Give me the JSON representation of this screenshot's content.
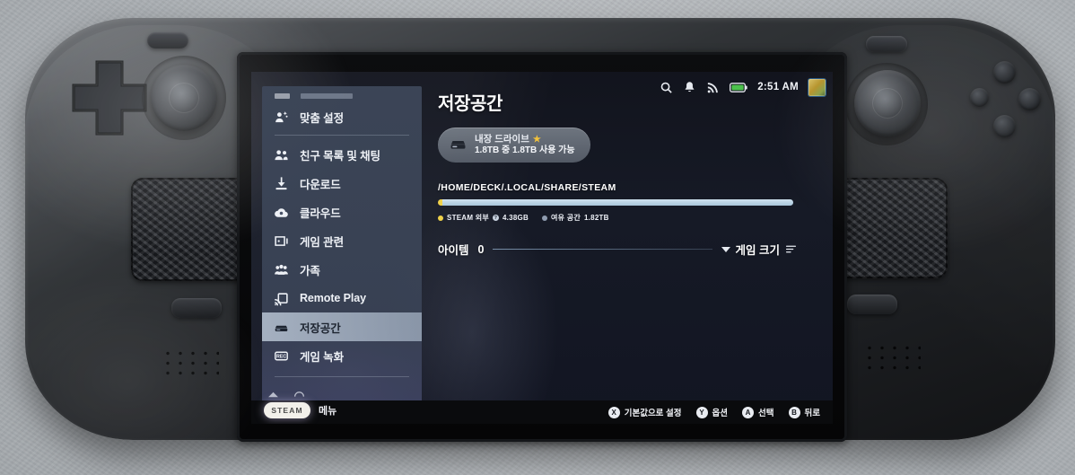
{
  "device": {
    "name": "Steam Deck handheld console"
  },
  "statusbar": {
    "icons": [
      "search-icon",
      "notification-bell-icon",
      "wifi-icon",
      "battery-icon"
    ],
    "time": "2:51 AM",
    "avatar": "user-avatar"
  },
  "sidebar": {
    "items": [
      {
        "label": "맞춤 설정",
        "icon": "personalize-icon",
        "selected": false
      },
      {
        "label": "친구 목록 및 채팅",
        "icon": "friends-icon",
        "selected": false
      },
      {
        "label": "다운로드",
        "icon": "download-icon",
        "selected": false
      },
      {
        "label": "클라우드",
        "icon": "cloud-icon",
        "selected": false
      },
      {
        "label": "게임 관련",
        "icon": "game-icon",
        "selected": false
      },
      {
        "label": "가족",
        "icon": "family-icon",
        "selected": false
      },
      {
        "label": "Remote Play",
        "icon": "remote-play-icon",
        "selected": false
      },
      {
        "label": "저장공간",
        "icon": "storage-drive-icon",
        "selected": true
      },
      {
        "label": "게임 녹화",
        "icon": "rec-icon",
        "selected": false
      }
    ],
    "steam_pill": "STEAM",
    "menu_label": "메뉴"
  },
  "main": {
    "title": "저장공간",
    "drive": {
      "name": "내장 드라이브",
      "starred": true,
      "capacity_line": "1.8TB 중 1.8TB 사용 가능"
    },
    "path": "/HOME/DECK/.LOCAL/SHARE/STEAM",
    "legend": [
      {
        "label": "STEAM 외부",
        "value": "4.38GB",
        "color": "#f0d24a",
        "has_help": true
      },
      {
        "label": "여유 공간",
        "value": "1.82TB",
        "color": "#8f9cb0",
        "has_help": false
      }
    ],
    "item_count_label": "아이템",
    "item_count": "0",
    "sort_label": "게임 크기"
  },
  "actionbar": [
    {
      "button": "X",
      "label": "기본값으로 설정"
    },
    {
      "button": "Y",
      "label": "옵션"
    },
    {
      "button": "A",
      "label": "선택"
    },
    {
      "button": "B",
      "label": "뒤로"
    }
  ],
  "chart_data": {
    "type": "bar",
    "title": "Storage usage — /HOME/DECK/.LOCAL/SHARE/STEAM",
    "categories": [
      "STEAM 외부",
      "여유 공간"
    ],
    "values": [
      4.38,
      1820
    ],
    "units": "GB",
    "colors": [
      "#f0d24a",
      "#b9d3e4"
    ],
    "total_label": "1.8TB",
    "used_fraction_percent": 0.24,
    "legend_position": "below"
  }
}
